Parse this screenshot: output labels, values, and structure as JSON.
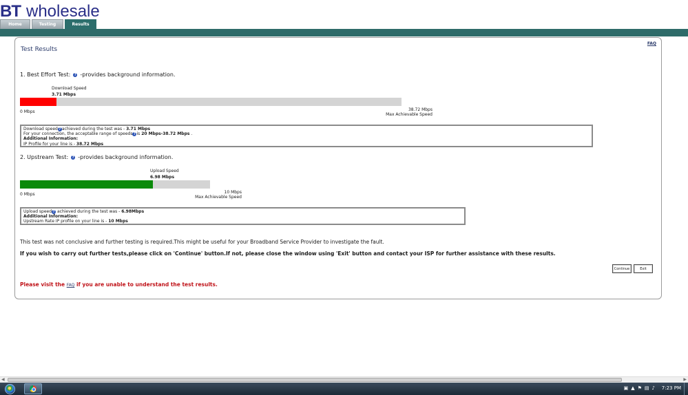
{
  "brand": {
    "bt": "BT",
    "name": "wholesale"
  },
  "tabs": [
    {
      "label": "Home"
    },
    {
      "label": "Testing"
    },
    {
      "label": "Results"
    }
  ],
  "panel": {
    "title": "Test Results",
    "faq": "FAQ"
  },
  "best_effort": {
    "heading": "1. Best Effort Test:",
    "help": "-provides background information.",
    "meter_label": "Download Speed",
    "meter_value": "3.71 Mbps",
    "fill_fraction": 0.0958,
    "min_label": "0 Mbps",
    "max_value": "38.72 Mbps",
    "max_label": "Max Achievable Speed",
    "info": {
      "line1_a": "Download speed",
      "line1_b": "achieved during the test was - ",
      "line1_val": "3.71 Mbps",
      "line2_a": "For your connection, the acceptable range of speeds",
      "line2_b": "is ",
      "line2_val": "20 Mbps-38.72 Mbps",
      "line2_end": " .",
      "line3": "Additional Information:",
      "line4_a": "IP Profile for your line is - ",
      "line4_val": "38.72 Mbps"
    }
  },
  "upstream": {
    "heading": "2. Upstream Test:",
    "help": "-provides background information.",
    "meter_label": "Upload Speed",
    "meter_value": "6.98 Mbps",
    "fill_fraction": 0.698,
    "min_label": "0 Mbps",
    "max_value": "10 Mbps",
    "max_label": "Max Achievable Speed",
    "info": {
      "line1_a": "Upload speed",
      "line1_b": " achieved during the test was - ",
      "line1_val": "6.98Mbps",
      "line2": "Additional Information:",
      "line3_a": "Upstream Rate IP profile on your line is - ",
      "line3_val": "10 Mbps"
    }
  },
  "notes": {
    "inconclusive": "This test was not conclusive and further testing is required.This might be useful for your Broadband Service Provider to investigate the fault.",
    "instructions": "If you wish to carry out further tests,please click on 'Continue' button.If not, please close the window using 'Exit' button and contact your ISP for further assistance with these results."
  },
  "buttons": {
    "continue": "Continue",
    "exit": "Exit"
  },
  "warning": {
    "before": "Please visit the ",
    "link": "FAQ",
    "after": " if you are unable to understand the test results."
  },
  "taskbar": {
    "clock": "7:23 PM"
  },
  "colors": {
    "download_fill": "#ff0000",
    "upload_fill": "#0a8a0a",
    "track": "#d4d4d4",
    "brand": "#2a2f88",
    "band": "#2e6b69",
    "warning": "#c0141a"
  }
}
